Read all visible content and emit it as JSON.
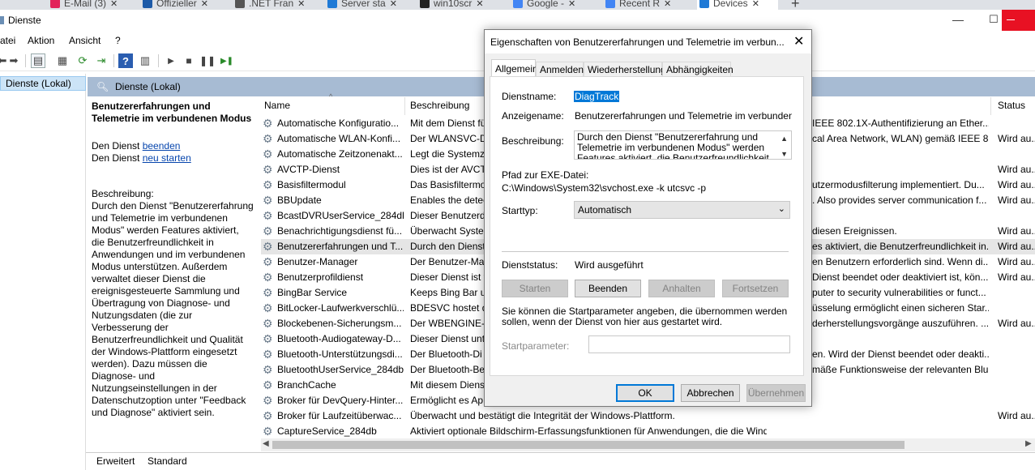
{
  "browser_tabs": [
    {
      "label": "E-Mail (3)",
      "icon": "at-icon",
      "color": "#e2225a"
    },
    {
      "label": "Offizieller",
      "icon": "hp-icon",
      "color": "#1d5aa8"
    },
    {
      "label": ".NET Fran",
      "icon": "globe-icon",
      "color": "#555555"
    },
    {
      "label": "Server sta",
      "icon": "vs-icon",
      "color": "#1f7ad6"
    },
    {
      "label": "win10scr",
      "icon": "github-icon",
      "color": "#222222"
    },
    {
      "label": "Google -",
      "icon": "google-icon",
      "color": "#4285f4"
    },
    {
      "label": "Recent R",
      "icon": "google-icon",
      "color": "#4285f4"
    },
    {
      "label": "Devices",
      "icon": "vs-icon",
      "color": "#1f7ad6"
    }
  ],
  "window": {
    "title": "Dienste"
  },
  "menu": [
    "atei",
    "Aktion",
    "Ansicht",
    "?"
  ],
  "tree": {
    "selected": "Dienste (Lokal)"
  },
  "pane_header": "Dienste (Lokal)",
  "desc_panel": {
    "title": "Benutzererfahrungen und Telemetrie im verbundenen Modus",
    "line1_prefix": "Den Dienst ",
    "link_stop": "beenden",
    "line2_prefix": "Den Dienst ",
    "link_restart": "neu starten",
    "desc_label": "Beschreibung:",
    "desc_text": "Durch den Dienst \"Benutzererfahrung und Telemetrie im verbundenen Modus\" werden Features aktiviert, die Benutzerfreundlichkeit in Anwendungen und im verbundenen Modus unterstützen. Außerdem verwaltet dieser Dienst die ereignisgesteuerte Sammlung und Übertragung von Diagnose- und Nutzungsdaten (die zur Verbesserung der Benutzerfreundlichkeit und Qualität der Windows-Plattform eingesetzt werden). Dazu müssen die Diagnose- und Nutzungseinstellungen in der Datenschutzoption unter \"Feedback und Diagnose\" aktiviert sein."
  },
  "columns": {
    "name": "Name",
    "description": "Beschreibung",
    "status": "Status"
  },
  "services": [
    {
      "name": "Automatische Konfiguratio...",
      "desc": "Mit dem Dienst fü",
      "desc2": "IEEE 802.1X-Authentifizierung an Ether...",
      "status": ""
    },
    {
      "name": "Automatische WLAN-Konfi...",
      "desc": "Der WLANSVC-Di",
      "desc2": "cal Area Network, WLAN) gemäß IEEE 8...",
      "status": "Wird au..."
    },
    {
      "name": "Automatische Zeitzonenakt...",
      "desc": "Legt die Systemze",
      "desc2": "",
      "status": ""
    },
    {
      "name": "AVCTP-Dienst",
      "desc": "Dies ist der AVCTI",
      "desc2": "",
      "status": "Wird au..."
    },
    {
      "name": "Basisfiltermodul",
      "desc": "Das Basisfiltermod",
      "desc2": "utzermodusfilterung implementiert. Du...",
      "status": "Wird au..."
    },
    {
      "name": "BBUpdate",
      "desc": "Enables the detec",
      "desc2": ". Also provides server communication f...",
      "status": "Wird au..."
    },
    {
      "name": "BcastDVRUserService_284db",
      "desc": "Dieser Benutzerdi",
      "desc2": "",
      "status": ""
    },
    {
      "name": "Benachrichtigungsdienst fü...",
      "desc": "Überwacht Syster",
      "desc2": "diesen Ereignissen.",
      "status": "Wird au..."
    },
    {
      "name": "Benutzererfahrungen und T...",
      "desc": "Durch den Dienst",
      "desc2": "es aktiviert, die Benutzerfreundlichkeit in...",
      "status": "Wird au..."
    },
    {
      "name": "Benutzer-Manager",
      "desc": "Der Benutzer-Ma",
      "desc2": "en Benutzern erforderlich sind. Wenn di...",
      "status": "Wird au..."
    },
    {
      "name": "Benutzerprofildienst",
      "desc": "Dieser Dienst ist f",
      "desc2": "Dienst beendet oder deaktiviert ist, kön...",
      "status": "Wird au..."
    },
    {
      "name": "BingBar Service",
      "desc": "Keeps Bing Bar up",
      "desc2": "puter to security vulnerabilities or funct...",
      "status": ""
    },
    {
      "name": "BitLocker-Laufwerkverschlü...",
      "desc": "BDESVC hostet de",
      "desc2": "üsselung ermöglicht einen sicheren Star...",
      "status": ""
    },
    {
      "name": "Blockebenen-Sicherungsm...",
      "desc": "Der WBENGINE-D",
      "desc2": "derherstellungsvorgänge auszuführen. ...",
      "status": "Wird au..."
    },
    {
      "name": "Bluetooth-Audiogateway-D...",
      "desc": "Dieser Dienst unte",
      "desc2": "",
      "status": ""
    },
    {
      "name": "Bluetooth-Unterstützungsdi...",
      "desc": "Der Bluetooth-Di",
      "desc2": "en. Wird der Dienst beendet oder deakti...",
      "status": ""
    },
    {
      "name": "BluetoothUserService_284db",
      "desc": "Der Bluetooth-Be",
      "desc2": "mäße Funktionsweise der relevanten Blu...",
      "status": ""
    },
    {
      "name": "BranchCache",
      "desc": "Mit diesem Diens",
      "desc2": "",
      "status": ""
    },
    {
      "name": "Broker für DevQuery-Hinter...",
      "desc": "Ermöglicht es Ap",
      "desc2": "",
      "status": ""
    },
    {
      "name": "Broker für Laufzeitüberwac...",
      "desc": "Überwacht und bestätigt die Integrität der Windows-Plattform.",
      "desc2": "",
      "status": "Wird au..."
    },
    {
      "name": "CaptureService_284db",
      "desc": "Aktiviert optionale Bildschirm-Erfassungsfunktionen für Anwendungen, die die Windows.Graphics.Capture-API aufrufen.",
      "desc2": "",
      "status": ""
    }
  ],
  "bottom_tabs": [
    "Erweitert",
    "Standard"
  ],
  "dialog": {
    "title": "Eigenschaften von Benutzererfahrungen und Telemetrie im verbun...",
    "tabs": [
      "Allgemein",
      "Anmelden",
      "Wiederherstellung",
      "Abhängigkeiten"
    ],
    "service_name_label": "Dienstname:",
    "service_name": "DiagTrack",
    "display_name_label": "Anzeigename:",
    "display_name": "Benutzererfahrungen und Telemetrie im verbundenen Mo",
    "description_label": "Beschreibung:",
    "description": "Durch den Dienst \"Benutzererfahrung und Telemetrie im verbundenen Modus\" werden Features aktiviert, die Benutzerfreundlichkeit in",
    "exe_label": "Pfad zur EXE-Datei:",
    "exe_path": "C:\\Windows\\System32\\svchost.exe -k utcsvc -p",
    "start_type_label": "Starttyp:",
    "start_type": "Automatisch",
    "status_label": "Dienststatus:",
    "status": "Wird ausgeführt",
    "btn_start": "Starten",
    "btn_stop": "Beenden",
    "btn_pause": "Anhalten",
    "btn_resume": "Fortsetzen",
    "hint": "Sie können die Startparameter angeben, die übernommen werden sollen, wenn der Dienst von hier aus gestartet wird.",
    "param_label": "Startparameter:",
    "param_value": "",
    "ok": "OK",
    "cancel": "Abbrechen",
    "apply": "Übernehmen"
  }
}
